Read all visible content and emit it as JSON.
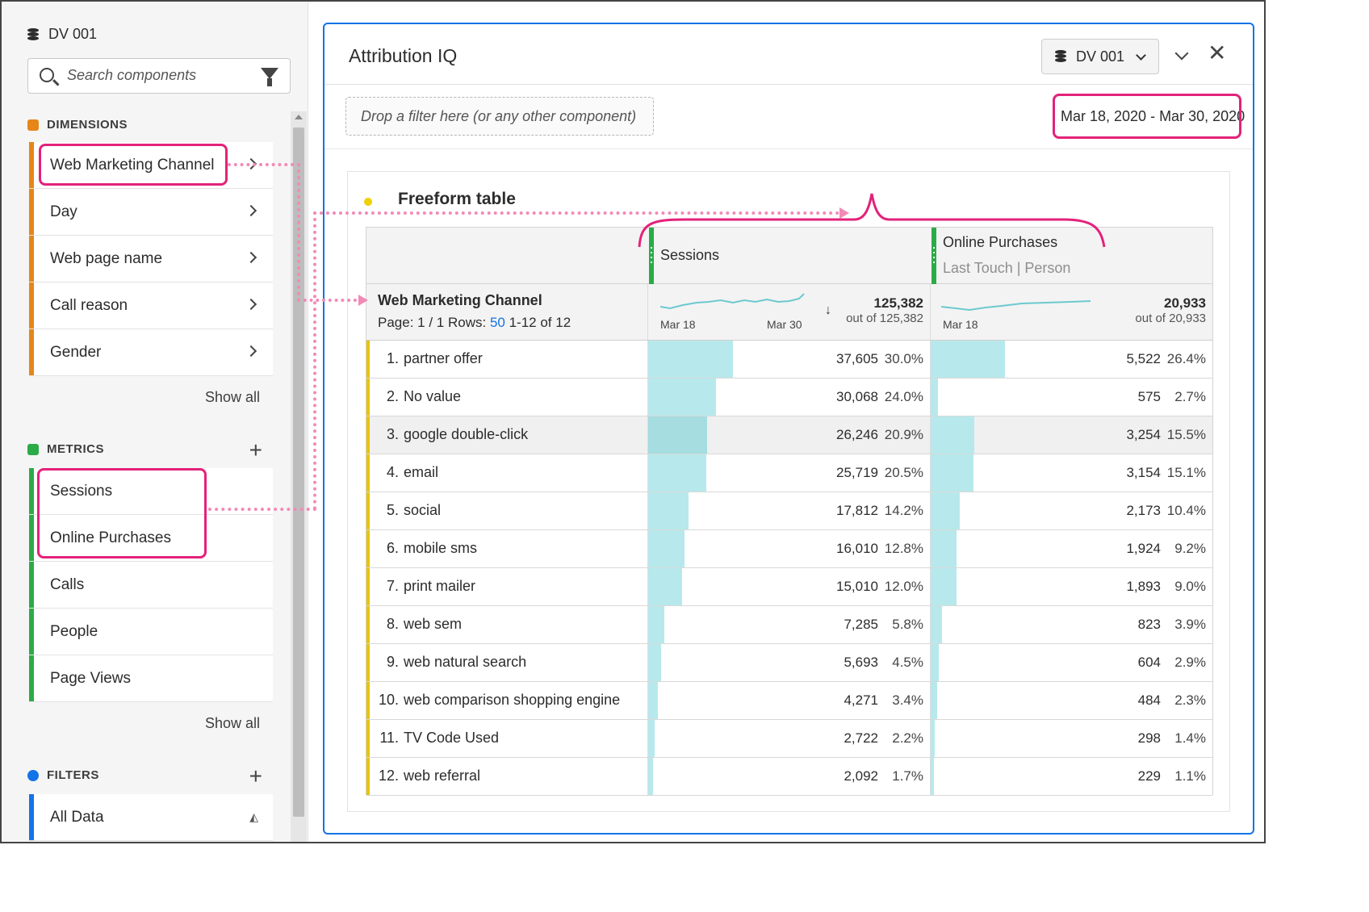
{
  "rail": {
    "data_source": "DV 001",
    "search_placeholder": "Search components",
    "dimensions": {
      "heading": "DIMENSIONS",
      "items": [
        "Web Marketing Channel",
        "Day",
        "Web page name",
        "Call reason",
        "Gender"
      ],
      "show_all": "Show all"
    },
    "metrics": {
      "heading": "METRICS",
      "items": [
        "Sessions",
        "Online Purchases",
        "Calls",
        "People",
        "Page Views"
      ],
      "show_all": "Show all"
    },
    "filters": {
      "heading": "FILTERS",
      "items": [
        "All Data"
      ]
    }
  },
  "panel": {
    "title": "Attribution IQ",
    "data_source": "DV 001",
    "drop_zone": "Drop a filter here (or any other component)",
    "date_range": "Mar 18, 2020 - Mar 30, 2020",
    "freeform_title": "Freeform table"
  },
  "table": {
    "dimension": "Web Marketing Channel",
    "page_label": "Page: 1 / 1",
    "rows_label": "Rows:",
    "rows_value": "50",
    "range_label": "1-12 of 12",
    "metrics": [
      {
        "name": "Sessions",
        "subtitle": "",
        "total": "125,382",
        "out_of": "out of 125,382",
        "spark_start": "Mar 18",
        "spark_end": "Mar 30"
      },
      {
        "name": "Online Purchases",
        "subtitle": "Last Touch | Person",
        "total": "20,933",
        "out_of": "out of 20,933",
        "spark_start": "Mar 18",
        "spark_end": ""
      }
    ],
    "rows": [
      {
        "rank": "1.",
        "name": "partner offer",
        "v1": "37,605",
        "p1": "30.0%",
        "v2": "5,522",
        "p2": "26.4%",
        "f1": 0.3,
        "f2": 0.264
      },
      {
        "rank": "2.",
        "name": "No value",
        "v1": "30,068",
        "p1": "24.0%",
        "v2": "575",
        "p2": "2.7%",
        "f1": 0.24,
        "f2": 0.027
      },
      {
        "rank": "3.",
        "name": "google double-click",
        "v1": "26,246",
        "p1": "20.9%",
        "v2": "3,254",
        "p2": "15.5%",
        "f1": 0.209,
        "f2": 0.155
      },
      {
        "rank": "4.",
        "name": "email",
        "v1": "25,719",
        "p1": "20.5%",
        "v2": "3,154",
        "p2": "15.1%",
        "f1": 0.205,
        "f2": 0.151
      },
      {
        "rank": "5.",
        "name": "social",
        "v1": "17,812",
        "p1": "14.2%",
        "v2": "2,173",
        "p2": "10.4%",
        "f1": 0.142,
        "f2": 0.104
      },
      {
        "rank": "6.",
        "name": "mobile sms",
        "v1": "16,010",
        "p1": "12.8%",
        "v2": "1,924",
        "p2": "9.2%",
        "f1": 0.128,
        "f2": 0.092
      },
      {
        "rank": "7.",
        "name": "print mailer",
        "v1": "15,010",
        "p1": "12.0%",
        "v2": "1,893",
        "p2": "9.0%",
        "f1": 0.12,
        "f2": 0.09
      },
      {
        "rank": "8.",
        "name": "web sem",
        "v1": "7,285",
        "p1": "5.8%",
        "v2": "823",
        "p2": "3.9%",
        "f1": 0.058,
        "f2": 0.039
      },
      {
        "rank": "9.",
        "name": "web natural search",
        "v1": "5,693",
        "p1": "4.5%",
        "v2": "604",
        "p2": "2.9%",
        "f1": 0.045,
        "f2": 0.029
      },
      {
        "rank": "10.",
        "name": "web comparison shopping engine",
        "v1": "4,271",
        "p1": "3.4%",
        "v2": "484",
        "p2": "2.3%",
        "f1": 0.034,
        "f2": 0.023
      },
      {
        "rank": "11.",
        "name": "TV Code Used",
        "v1": "2,722",
        "p1": "2.2%",
        "v2": "298",
        "p2": "1.4%",
        "f1": 0.022,
        "f2": 0.014
      },
      {
        "rank": "12.",
        "name": "web referral",
        "v1": "2,092",
        "p1": "1.7%",
        "v2": "229",
        "p2": "1.1%",
        "f1": 0.017,
        "f2": 0.011
      }
    ]
  },
  "colors": {
    "dimension_bar": "#e68619",
    "metric_bar": "#2bab48",
    "filter_bar": "#1473e6",
    "panel_border": "#1473e6",
    "annotation": "#e3227a",
    "annotation_dotted": "#f28ab6",
    "row_marker": "#e8c400",
    "bar_fill": "#b7e9ec",
    "sparkline": "#6cc9cf"
  },
  "icons": {
    "data_source": "database-icon",
    "search": "search-icon",
    "filter": "funnel-icon",
    "collapse": "chevron-down-icon",
    "close": "close-icon",
    "sort": "arrow-down-icon"
  }
}
